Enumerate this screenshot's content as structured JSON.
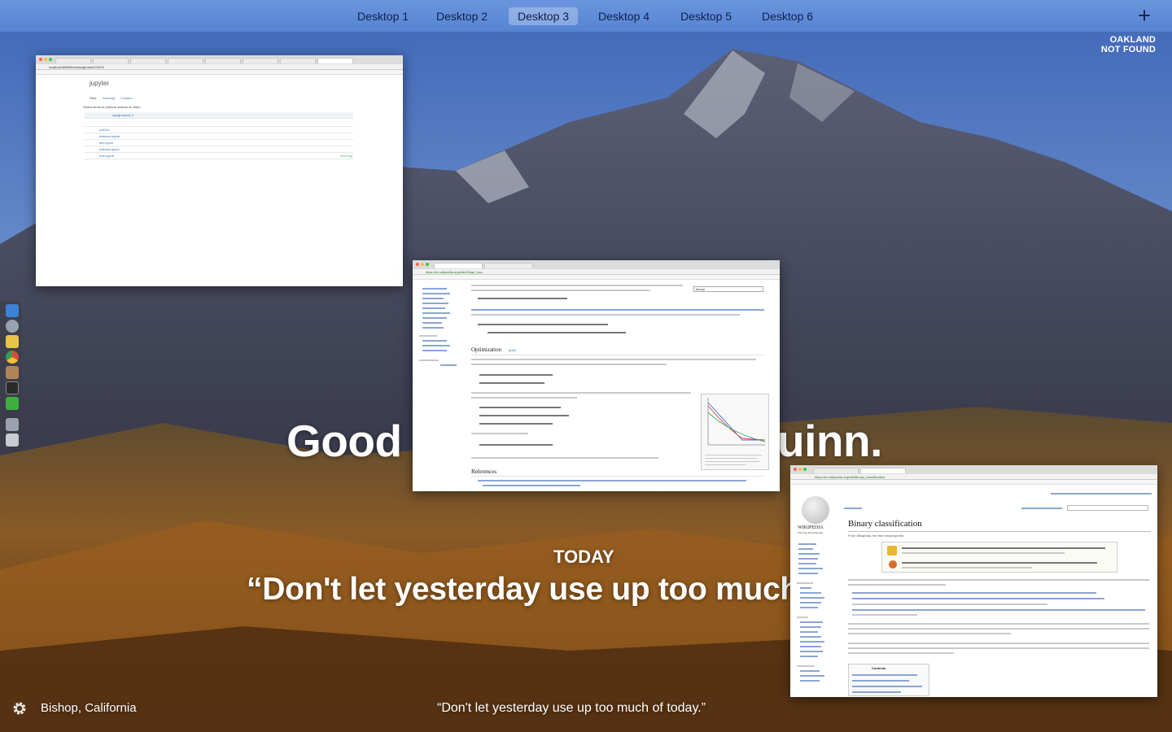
{
  "spaces_bar": {
    "tabs": [
      {
        "label": "Desktop 1",
        "active": false
      },
      {
        "label": "Desktop 2",
        "active": false
      },
      {
        "label": "Desktop 3",
        "active": true
      },
      {
        "label": "Desktop 4",
        "active": false
      },
      {
        "label": "Desktop 5",
        "active": false
      },
      {
        "label": "Desktop 6",
        "active": false
      }
    ],
    "add_icon": "plus-icon",
    "add_label": "+"
  },
  "corner_badge": {
    "line1": "OAKLAND",
    "line2": "NOT FOUND"
  },
  "dock": {
    "items": [
      {
        "icon": "finder-icon",
        "color": "#3b82d6"
      },
      {
        "icon": "launchpad-icon",
        "color": "#9aa3ad"
      },
      {
        "icon": "notes-icon",
        "color": "#e8c34a"
      },
      {
        "icon": "chrome-icon",
        "color": "#3b9a57"
      },
      {
        "icon": "photos-icon",
        "color": "#b0845a"
      },
      {
        "icon": "terminal-icon",
        "color": "#2b2b2b"
      },
      {
        "icon": "spotify-icon",
        "color": "#3fae3f"
      },
      {
        "icon": "downloads-icon",
        "color": "#9aa3ad"
      },
      {
        "icon": "trash-icon",
        "color": "#c7ccd2"
      }
    ]
  },
  "momentum": {
    "greeting": "Good",
    "greeting_tail": "uinn.",
    "today_label": "TODAY",
    "today_focus": "“Don't let yesterday use up too much",
    "location": "Bishop, California",
    "bottom_quote": "“Don't let yesterday use up too much of today.”",
    "settings_icon": "gear-icon"
  },
  "windows": {
    "jupyter": {
      "url": "localhost:8888/tree/assignment1%202",
      "logo": "jupyter",
      "tabs_nav": [
        "Files",
        "Running",
        "Clusters"
      ],
      "instruction": "Select items to perform actions on them.",
      "folder": "assignment1 2",
      "files": [
        "cs231n",
        "features.ipynb",
        "knn.ipynb",
        "softmax.ipynb",
        "svm.ipynb"
      ],
      "running_label": "Running"
    },
    "hinge": {
      "url": "https://en.wikipedia.org/wiki/Hinge_loss",
      "search_value": "binary",
      "heading_optimization": "Optimization",
      "heading_references": "References",
      "edit_label": "[edit]"
    },
    "binary": {
      "url": "https://en.wikipedia.org/wiki/Binary_classification",
      "title": "Binary classification",
      "from_line": "From Wikipedia, the free encyclopedia",
      "logo_text": "WIKIPEDIA",
      "logo_sub": "The Free Encyclopedia",
      "contents_label": "Contents"
    }
  }
}
